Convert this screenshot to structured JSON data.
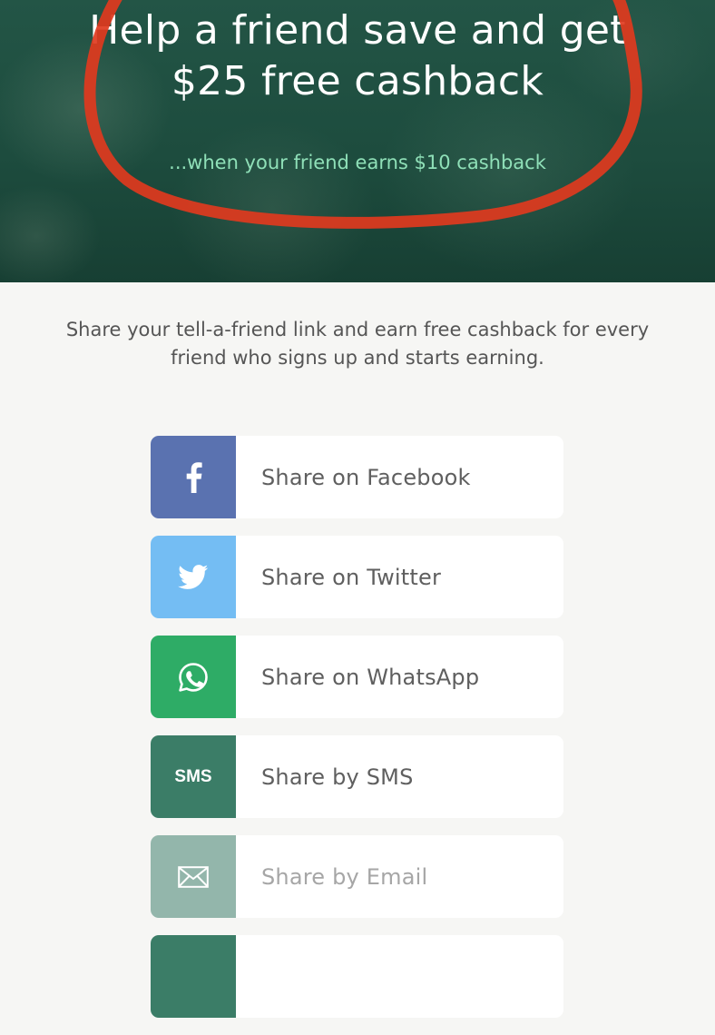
{
  "hero": {
    "title_line1": "Help a friend save and get",
    "title_line2": "$25 free cashback",
    "subtitle": "...when your friend earns $10 cashback"
  },
  "intro_text": "Share your tell-a-friend link and earn free cashback for every friend who signs up and starts earning.",
  "share_options": [
    {
      "label": "Share on Facebook",
      "icon": "facebook-icon",
      "color": "#5a72b0"
    },
    {
      "label": "Share on Twitter",
      "icon": "twitter-icon",
      "color": "#74bdf3"
    },
    {
      "label": "Share on WhatsApp",
      "icon": "whatsapp-icon",
      "color": "#2eac66"
    },
    {
      "label": "Share by SMS",
      "icon": "sms-icon",
      "icon_text": "SMS",
      "color": "#3b7d67"
    },
    {
      "label": "Share by Email",
      "icon": "email-icon",
      "color": "#93b6ab"
    },
    {
      "label": "",
      "icon": "",
      "color": "#3b7d67"
    }
  ],
  "colors": {
    "hero_background": "#1f4f41",
    "subtitle": "#8fe0b8",
    "annotation_circle": "#e03a1e",
    "page_background": "#f6f6f4"
  }
}
